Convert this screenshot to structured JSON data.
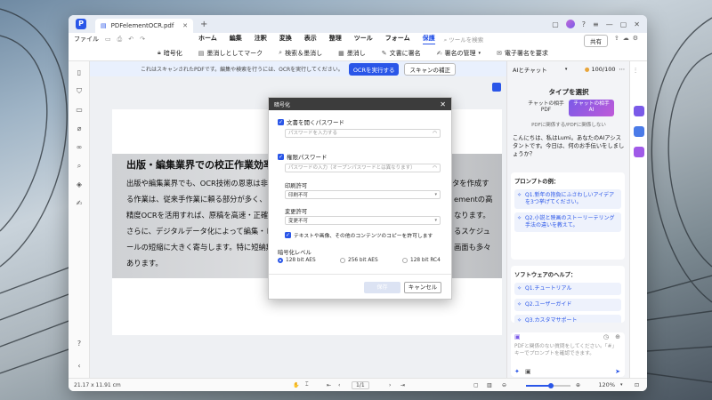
{
  "app": {
    "tab_title": "PDFelementOCR.pdf",
    "menu_file": "ファイル",
    "menus": [
      "ホーム",
      "編集",
      "注釈",
      "変換",
      "表示",
      "整理",
      "ツール",
      "フォーム",
      "保護"
    ],
    "active_menu": "保護",
    "search_placeholder": "ツールを検索",
    "share": "共有"
  },
  "toolbar": {
    "items": [
      "暗号化",
      "墨消しとしてマーク",
      "検索＆墨消し",
      "墨消し",
      "文書に署名",
      "署名の管理",
      "電子署名を要求"
    ]
  },
  "banner": {
    "message": "これはスキャンされたPDFです。編集や検索を行うには、OCRを実行してください。",
    "ocr_button": "OCRを実行する",
    "improve_button": "スキャンの補正"
  },
  "document": {
    "title": "出版・編集業界での校正作業効率化",
    "lines": [
      "出版や編集業界でも、OCR技術の恩恵は非常",
      "る作業は、従来手作業に頼る部分が多く、",
      "精度OCRを活用すれば、原稿を高速・正確に",
      "さらに、デジタルデータ化によって編集・レ",
      "ールの短縮に大きく寄与します。特に短納期",
      "あります。"
    ],
    "right_fragments": [
      "タを作成す",
      "ementの高",
      "なります。",
      "るスケジュ",
      "画面も多々"
    ]
  },
  "dialog": {
    "title": "暗号化",
    "open_password_label": "文書を開くパスワード",
    "open_password_placeholder": "パスワードを入力する",
    "permission_password_label": "権限パスワード",
    "permission_password_placeholder": "パスワードの入力（オープンパスワードとは異なります）",
    "print_label": "印刷許可",
    "print_value": "印刷不可",
    "change_label": "変更許可",
    "change_value": "変更不可",
    "copy_label": "テキストや画像、その他のコンテンツのコピーを許可します",
    "level_label": "暗号化レベル",
    "levels": [
      "128 bit AES",
      "256 bit AES",
      "128 bit RC4"
    ],
    "selected_level": "128 bit AES",
    "ok_button": "保存",
    "cancel_button": "キャンセル"
  },
  "ai_panel": {
    "mode": "AIとチャット",
    "counter": "100/100",
    "title": "タイプを選択",
    "type_pdf": "チャットの相手\nPDF",
    "type_ai": "チャットの相手\nAI",
    "note": "PDFに関係する/PDFに関係しない",
    "greeting": "こんにちは、私はLumi。あなたのAIアシスタントです。今日は、何のお手伝いをしましょうか？",
    "prompt_header": "プロンプトの例：",
    "prompts": [
      "Q1.新年の抱負にふさわしいアイデアを3つ挙げてください。",
      "Q2.小説と映画のストーリーテリング手法の違いを教えて。"
    ],
    "help_header": "ソフトウェアのヘルプ：",
    "help_items": [
      "Q1.チュートリアル",
      "Q2.ユーザーガイド",
      "Q3.カスタマサポート"
    ],
    "input_placeholder": "PDFと関係のない質問をしてください。「#」キーでプロンプトを確認できます。"
  },
  "status": {
    "dimensions": "21.17 x 11.91 cm",
    "page": "1/1",
    "zoom": "120%",
    "zoom_fraction": 0.55
  },
  "colors": {
    "accent": "#2a56e8",
    "dialog_header": "#3c3c3c"
  }
}
